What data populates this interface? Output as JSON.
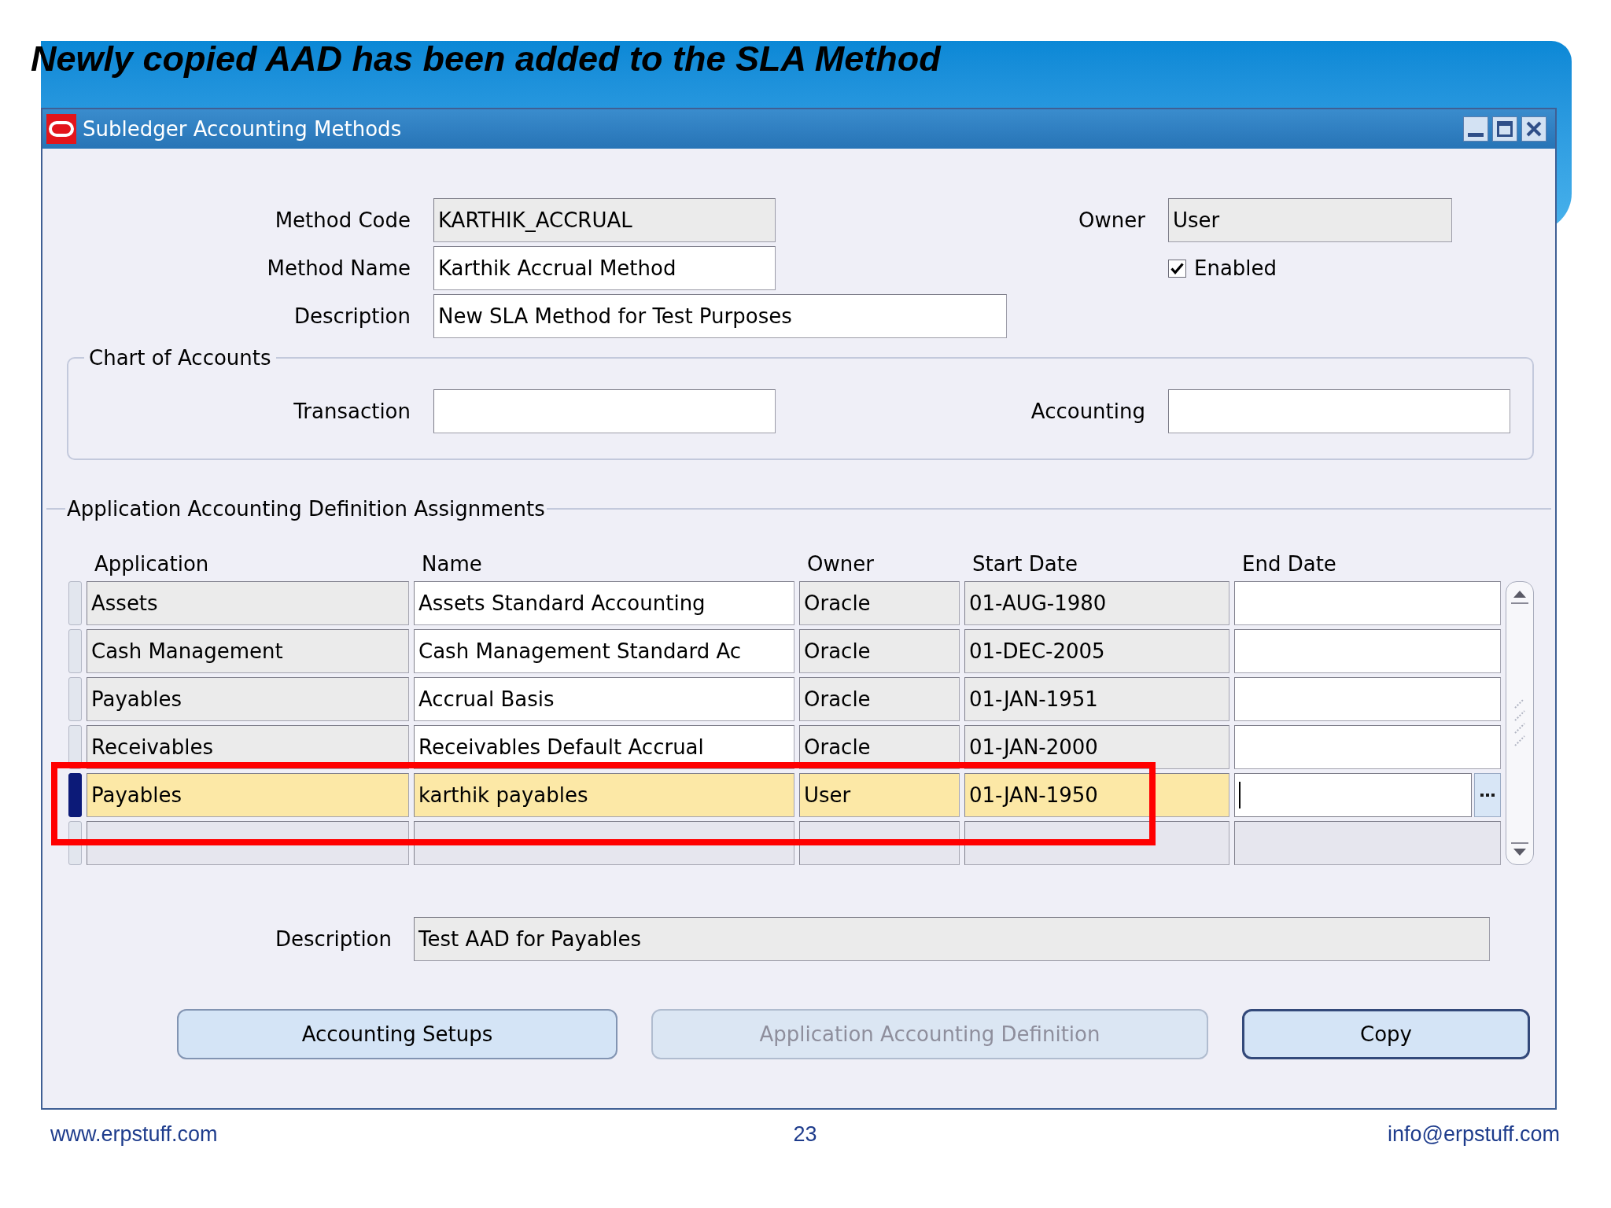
{
  "slide": {
    "title": "Newly copied AAD has been added to the SLA Method"
  },
  "window": {
    "title": "Subledger Accounting Methods"
  },
  "form": {
    "method_code": {
      "label": "Method Code",
      "value": "KARTHIK_ACCRUAL",
      "read_only": true
    },
    "method_name": {
      "label": "Method Name",
      "value": "Karthik Accrual Method",
      "read_only": false
    },
    "description": {
      "label": "Description",
      "value": "New SLA Method for Test Purposes",
      "read_only": false
    },
    "owner": {
      "label": "Owner",
      "value": "User",
      "read_only": true
    },
    "enabled": {
      "label": "Enabled",
      "checked": true
    }
  },
  "chart_of_accounts": {
    "title": "Chart of Accounts",
    "transaction": {
      "label": "Transaction",
      "read_only": false
    },
    "accounting": {
      "label": "Accounting",
      "read_only": false
    }
  },
  "assignments": {
    "title": "Application Accounting Definition Assignments",
    "columns": [
      {
        "label": "Application",
        "read_only": true
      },
      {
        "label": "Name",
        "read_only": false
      },
      {
        "label": "Owner",
        "read_only": true
      },
      {
        "label": "Start Date",
        "read_only": true
      },
      {
        "label": "End Date",
        "read_only": false
      }
    ],
    "rows": [
      {
        "kind": "record",
        "selected": false,
        "highlighted": false,
        "cells": [
          {
            "text": "Assets",
            "focused": false
          },
          {
            "text": "Assets Standard Accounting",
            "focused": false
          },
          {
            "text": "Oracle",
            "focused": false
          },
          {
            "text": "01-AUG-1980",
            "focused": false
          },
          {
            "focused": false
          }
        ]
      },
      {
        "kind": "record",
        "selected": false,
        "highlighted": false,
        "cells": [
          {
            "text": "Cash Management",
            "focused": false
          },
          {
            "text": "Cash Management Standard Ac",
            "focused": false
          },
          {
            "text": "Oracle",
            "focused": false
          },
          {
            "text": "01-DEC-2005",
            "focused": false
          },
          {
            "focused": false
          }
        ]
      },
      {
        "kind": "record",
        "selected": false,
        "highlighted": false,
        "cells": [
          {
            "text": "Payables",
            "focused": false
          },
          {
            "text": "Accrual Basis",
            "focused": false
          },
          {
            "text": "Oracle",
            "focused": false
          },
          {
            "text": "01-JAN-1951",
            "focused": false
          },
          {
            "focused": false
          }
        ]
      },
      {
        "kind": "record",
        "selected": false,
        "highlighted": false,
        "cells": [
          {
            "text": "Receivables",
            "focused": false
          },
          {
            "text": "Receivables Default Accrual",
            "focused": false
          },
          {
            "text": "Oracle",
            "focused": false
          },
          {
            "text": "01-JAN-2000",
            "focused": false
          },
          {
            "focused": false
          }
        ]
      },
      {
        "kind": "record",
        "selected": true,
        "highlighted": true,
        "cells": [
          {
            "text": "Payables",
            "focused": false
          },
          {
            "text": "karthik payables",
            "focused": false
          },
          {
            "text": "User",
            "focused": false
          },
          {
            "text": "01-JAN-1950",
            "focused": false
          },
          {
            "focused": true
          }
        ]
      },
      {
        "kind": "blank",
        "selected": false,
        "highlighted": false
      }
    ]
  },
  "assignment_description": {
    "label": "Description",
    "value": "Test AAD for Payables",
    "read_only": true
  },
  "buttons": [
    {
      "label": "Accounting Setups",
      "disabled": false,
      "default": false
    },
    {
      "label": "Application Accounting Definition",
      "disabled": true,
      "default": false
    },
    {
      "label": "Copy",
      "disabled": false,
      "default": true
    }
  ],
  "footer": {
    "website": "www.erpstuff.com",
    "page": "23",
    "email": "info@erpstuff.com"
  }
}
